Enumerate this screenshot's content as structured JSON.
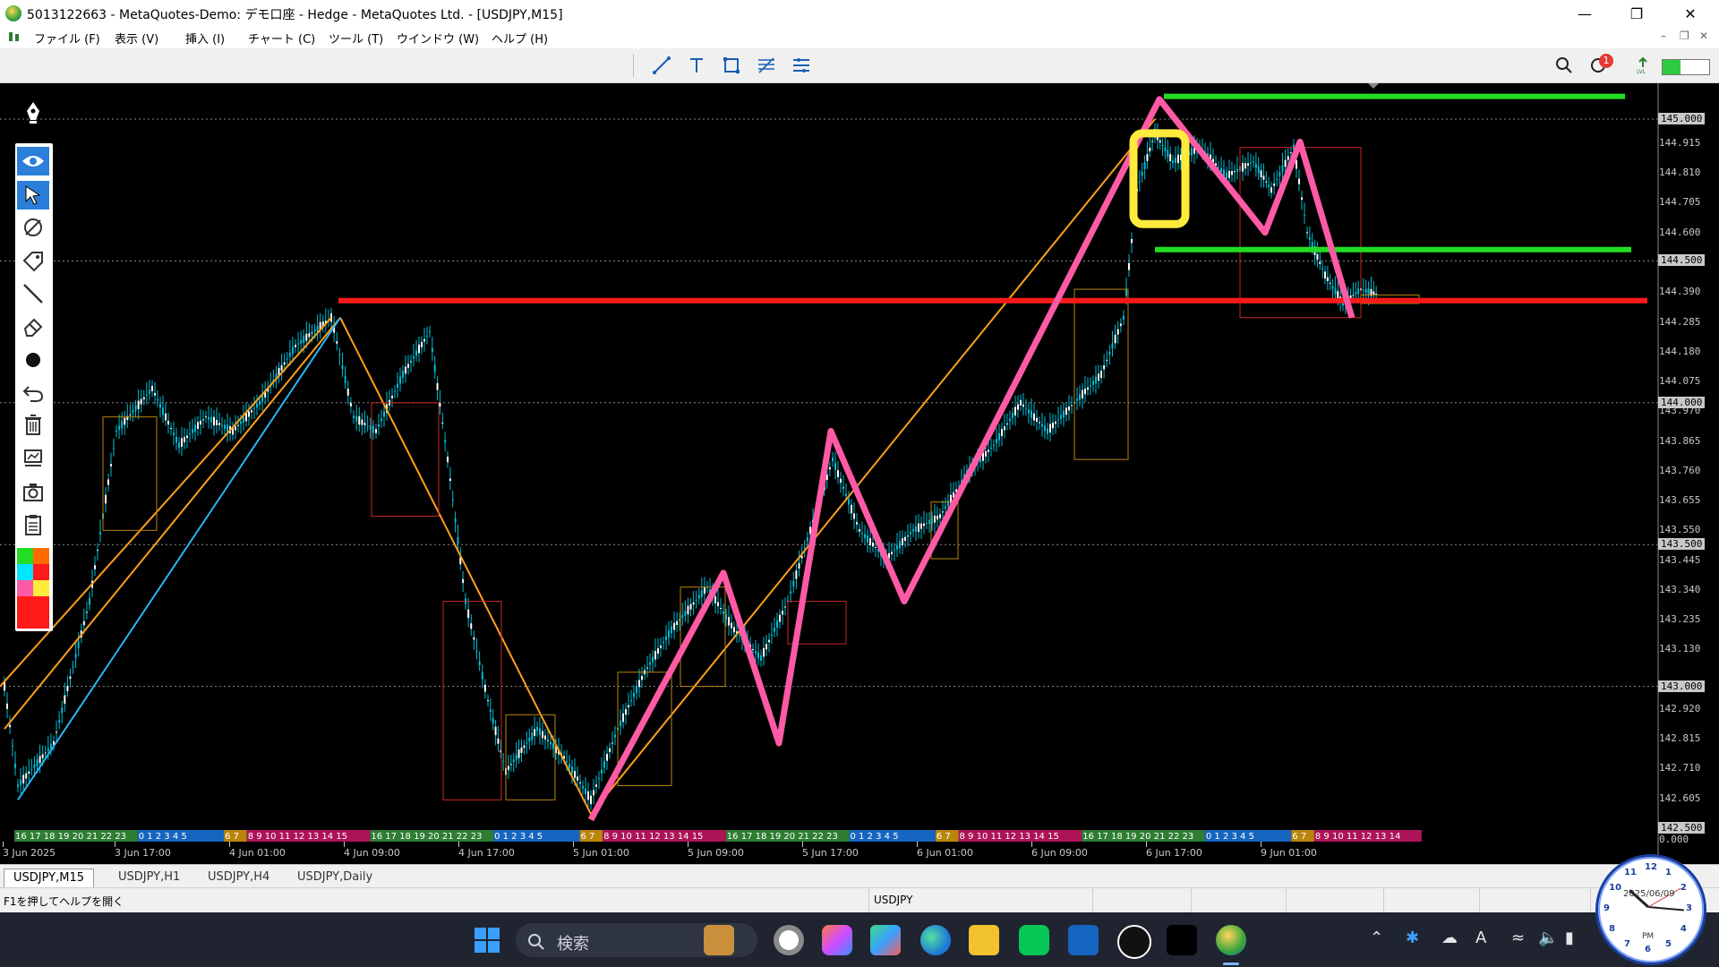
{
  "window": {
    "title": "5013122663 - MetaQuotes-Demo: デモ口座 - Hedge - MetaQuotes Ltd. - [USDJPY,M15]"
  },
  "menu": {
    "items": [
      "ファイル (F)",
      "表示 (V)",
      "挿入 (I)",
      "チャート (C)",
      "ツール (T)",
      "ウインドウ (W)",
      "ヘルプ (H)"
    ]
  },
  "toolbar": {
    "notification_count": "1"
  },
  "chart": {
    "symbol": "USDJPY",
    "timeframe": "M15",
    "price_labels": [
      "145.000",
      "144.915",
      "144.810",
      "144.705",
      "144.600",
      "144.500",
      "144.390",
      "144.285",
      "144.180",
      "144.075",
      "144.000",
      "143.970",
      "143.865",
      "143.760",
      "143.655",
      "143.550",
      "143.500",
      "143.445",
      "143.340",
      "143.235",
      "143.130",
      "143.000",
      "142.920",
      "142.815",
      "142.710",
      "142.605",
      "142.500",
      "0.000"
    ],
    "date_labels": [
      "3 Jun 2025",
      "3 Jun 17:00",
      "4 Jun 01:00",
      "4 Jun 09:00",
      "4 Jun 17:00",
      "5 Jun 01:00",
      "5 Jun 09:00",
      "5 Jun 17:00",
      "6 Jun 01:00",
      "6 Jun 09:00",
      "6 Jun 17:00",
      "9 Jun 01:00"
    ],
    "hour_strip": [
      {
        "text": "16 17 18 19 20 21 22 23",
        "color": "#2e7d32"
      },
      {
        "text": "0  1  2  3  4  5",
        "color": "#1565c0"
      },
      {
        "text": "6  7",
        "color": "#b8860b"
      },
      {
        "text": "8  9  10 11 12 13 14 15",
        "color": "#ad1457"
      },
      {
        "text": "16 17 18 19 20 21 22 23",
        "color": "#2e7d32"
      },
      {
        "text": "0  1  2  3  4  5",
        "color": "#1565c0"
      },
      {
        "text": "6  7",
        "color": "#b8860b"
      },
      {
        "text": "8  9  10 11 12 13 14 15",
        "color": "#ad1457"
      },
      {
        "text": "16 17 18 19 20 21 22 23",
        "color": "#2e7d32"
      },
      {
        "text": "0  1  2  3  4  5",
        "color": "#1565c0"
      },
      {
        "text": "6  7",
        "color": "#b8860b"
      },
      {
        "text": "8  9  10 11 12 13 14 15",
        "color": "#ad1457"
      },
      {
        "text": "16 17 18 19 20 21 22 23",
        "color": "#2e7d32"
      },
      {
        "text": "0  1  2  3  4  5",
        "color": "#1565c0"
      },
      {
        "text": "6  7",
        "color": "#b8860b"
      },
      {
        "text": "8  9  10 11 12 13 14",
        "color": "#ad1457"
      }
    ],
    "colors": {
      "background": "#000000",
      "candle": "#00bcd4",
      "resistance_line": "#ff1a1a",
      "support_line": "#22dd22",
      "zigzag": "#ff5aa5",
      "trend_line": "#ff9f1a",
      "highlight_box": "#ffeb3b"
    }
  },
  "tabs": [
    "USDJPY,M15",
    "USDJPY,H1",
    "USDJPY,H4",
    "USDJPY,Daily"
  ],
  "status": {
    "help_text": "F1を押してヘルプを開く",
    "symbol": "USDJPY"
  },
  "taskbar": {
    "search_placeholder": "検索"
  },
  "clock": {
    "date": "2025/06/09",
    "ampm": "PM"
  }
}
